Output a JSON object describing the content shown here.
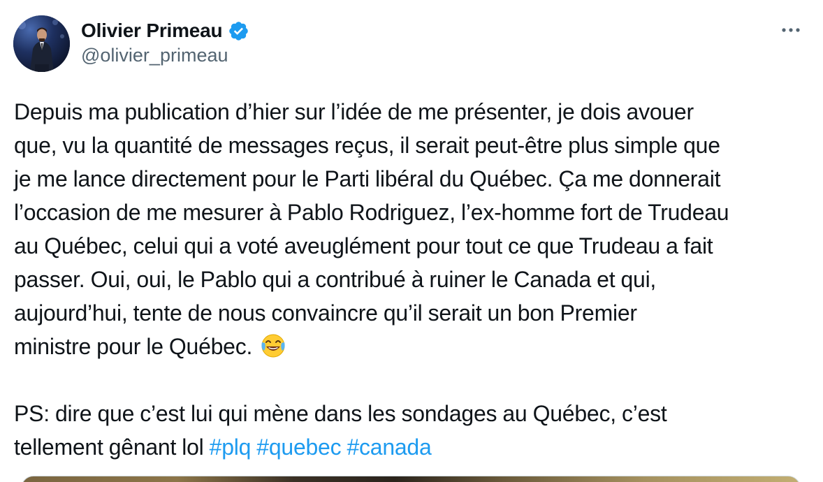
{
  "author": {
    "display_name": "Olivier Primeau",
    "handle": "@olivier_primeau",
    "verified": true,
    "avatar": "profile-photo"
  },
  "menu": {
    "more_icon": "more-horizontal-icon"
  },
  "tweet": {
    "lines": [
      "Depuis ma publication d’hier sur l’idée de me présenter, je dois avouer",
      "que, vu la quantité de messages reçus, il serait peut-être plus simple que",
      "je me lance directement pour le Parti libéral du Québec. Ça me donnerait",
      "l’occasion de me mesurer à Pablo Rodriguez, l’ex-homme fort de Trudeau",
      "au Québec, celui qui a voté aveuglément pour tout ce que Trudeau a fait",
      "passer. Oui, oui, le Pablo qui a contribué à ruiner le Canada et qui,",
      "aujourd’hui, tente de nous convaincre qu’il serait un bon Premier",
      "ministre pour le Québec."
    ],
    "emoji": "face-with-tears-of-joy",
    "ps_line1": "PS: dire que c’est lui qui mène dans les sondages au Québec, c’est",
    "ps_line2": "tellement gênant lol",
    "hashtags": [
      "#plq",
      "#quebec",
      "#canada"
    ]
  },
  "colors": {
    "text": "#0f1419",
    "secondary": "#536471",
    "link": "#1d9bf0",
    "verified": "#1d9bf0"
  }
}
